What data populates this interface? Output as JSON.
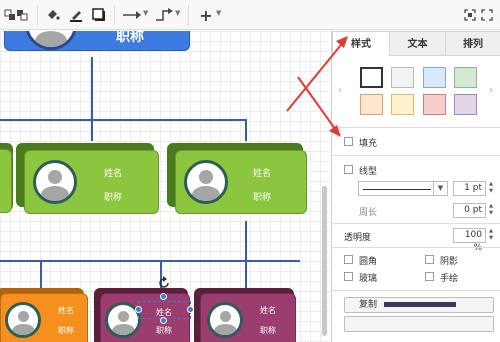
{
  "toolbar": {
    "icons": [
      "to-front-icon",
      "to-back-icon",
      "fill-color-icon",
      "line-color-icon",
      "shadow-icon",
      "connection-icon",
      "waypoints-icon",
      "insert-icon",
      "fit-icon",
      "fullscreen-icon"
    ]
  },
  "canvas": {
    "top_card": {
      "title": "职称"
    },
    "mid_cards": [
      {
        "name": "姓名",
        "title": "职称",
        "color": "#8cc63f"
      },
      {
        "name": "姓名",
        "title": "职称",
        "color": "#8cc63f"
      }
    ],
    "bottom_cards": [
      {
        "name": "姓名",
        "title": "职称",
        "color": "#f5901e"
      },
      {
        "name": "姓名",
        "title": "职称",
        "color": "#9b3d6e"
      },
      {
        "name": "姓名",
        "title": "职称",
        "color": "#9b3d6e"
      }
    ],
    "colors": {
      "blue": "#3d7be0",
      "line": "#3b5cad",
      "annotation": "#e53935"
    }
  },
  "panel": {
    "tabs": [
      {
        "label": "样式",
        "active": true
      },
      {
        "label": "文本",
        "active": false
      },
      {
        "label": "排列",
        "active": false
      }
    ],
    "swatches_row1": [
      "#ffffff",
      "#f3f3f3",
      "#dae8fc",
      "#d5e8d4"
    ],
    "swatches_row2": [
      "#ffe6cc",
      "#fff2cc",
      "#f8cecc",
      "#e1d5e7"
    ],
    "fill_label": "填充",
    "line_label": "线型",
    "line_width": "1 pt",
    "perimeter_label": "周长",
    "perimeter_value": "0 pt",
    "opacity_label": "透明度",
    "opacity_value": "100 %",
    "rounded_label": "圆角",
    "shadow_label": "阴影",
    "glass_label": "玻璃",
    "sketch_label": "手绘",
    "copy_button_label": "复制"
  }
}
